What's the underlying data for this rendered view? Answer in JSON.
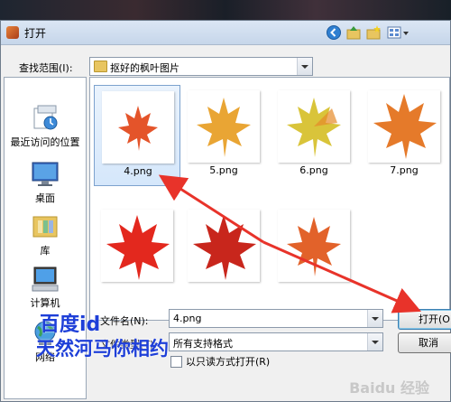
{
  "window": {
    "title": "打开"
  },
  "lookin": {
    "label": "查找范围(I):",
    "value": "抠好的枫叶图片"
  },
  "places": [
    {
      "label": "最近访问的位置",
      "icon": "recent-places-icon"
    },
    {
      "label": "桌面",
      "icon": "desktop-icon"
    },
    {
      "label": "库",
      "icon": "libraries-icon"
    },
    {
      "label": "计算机",
      "icon": "computer-icon"
    },
    {
      "label": "网络",
      "icon": "network-icon"
    }
  ],
  "files": [
    {
      "name": "4.png",
      "selected": true,
      "color": "#e4542a"
    },
    {
      "name": "5.png",
      "selected": false,
      "color": "#e9a534"
    },
    {
      "name": "6.png",
      "selected": false,
      "color": "#d9c43a"
    },
    {
      "name": "7.png",
      "selected": false,
      "color": "#e57a2a"
    },
    {
      "name": "",
      "selected": false,
      "color": "#e3281e"
    },
    {
      "name": "",
      "selected": false,
      "color": "#c8261c"
    },
    {
      "name": "",
      "selected": false,
      "color": "#e2622a"
    }
  ],
  "filename": {
    "label": "文件名(N):",
    "value": "4.png"
  },
  "filetype": {
    "label": "文件类型(T):",
    "value": "所有支持格式"
  },
  "readonly": {
    "label": "以只读方式打开(R)"
  },
  "buttons": {
    "open": "打开(O)",
    "cancel": "取消"
  },
  "watermark": {
    "line1": "百度id",
    "line2": "天然河马你相约",
    "baidu": "Baidu 经验"
  },
  "colors": {
    "arrow": "#e8332a",
    "watermark": "#1e3fd8",
    "selection": "#d5e7fb"
  }
}
